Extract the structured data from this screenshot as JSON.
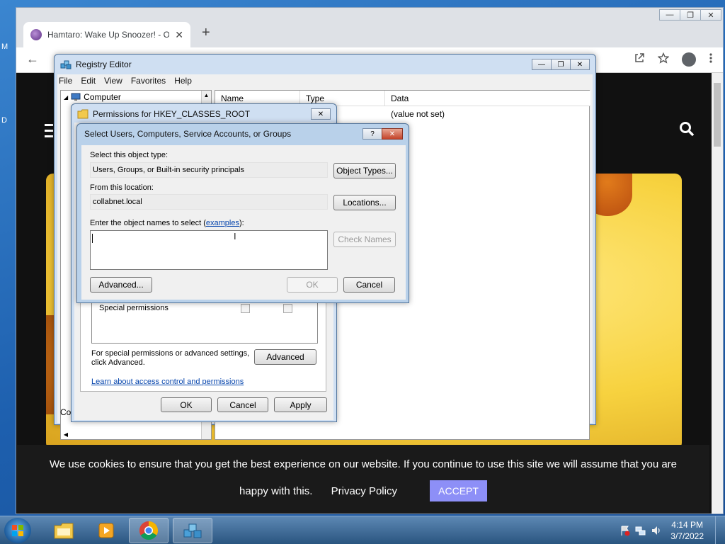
{
  "desktop": {
    "left_letters": [
      "M",
      "D"
    ]
  },
  "chrome": {
    "tab_title": "Hamtaro: Wake Up Snoozer! - Of",
    "tab_close": "✕",
    "new_tab": "+",
    "back": "←",
    "window_controls": [
      "—",
      "❐",
      "✕"
    ]
  },
  "website": {
    "cookie_text": "We use cookies to ensure that you get the best experience on our website. If you continue to use this site we will assume that you are",
    "cookie_text_2": "happy with this.",
    "privacy_label": "Privacy Policy",
    "accept_label": "ACCEPT"
  },
  "regedit": {
    "title": "Registry Editor",
    "menu": [
      "File",
      "Edit",
      "View",
      "Favorites",
      "Help"
    ],
    "tree_root": "Computer",
    "columns": [
      "Name",
      "Type",
      "Data"
    ],
    "row_data": "(value not set)",
    "status": "Co"
  },
  "permissions": {
    "title": "Permissions for HKEY_CLASSES_ROOT",
    "special_permissions": "Special permissions",
    "advanced_note": "For special permissions or advanced settings,\nclick Advanced.",
    "advanced_button": "Advanced",
    "learn_link": "Learn about access control and permissions",
    "ok": "OK",
    "cancel": "Cancel",
    "apply": "Apply"
  },
  "select_dialog": {
    "title": "Select Users, Computers, Service Accounts, or Groups",
    "help_glyph": "?",
    "object_type_label": "Select this object type:",
    "object_type_value": "Users, Groups, or Built-in security principals",
    "object_types_button": "Object Types...",
    "location_label": "From this location:",
    "location_value": "collabnet.local",
    "locations_button": "Locations...",
    "names_label_prefix": "Enter the object names to select (",
    "names_label_link": "examples",
    "names_label_suffix": "):",
    "names_value": "",
    "check_names_button": "Check Names",
    "advanced_button": "Advanced...",
    "ok": "OK",
    "cancel": "Cancel"
  },
  "taskbar": {
    "time": "4:14 PM",
    "date": "3/7/2022"
  },
  "colors": {
    "accept_bg": "#8d8ff7",
    "cookie_bg": "#1a1a1a",
    "hero_yellow": "#f7d23f"
  }
}
